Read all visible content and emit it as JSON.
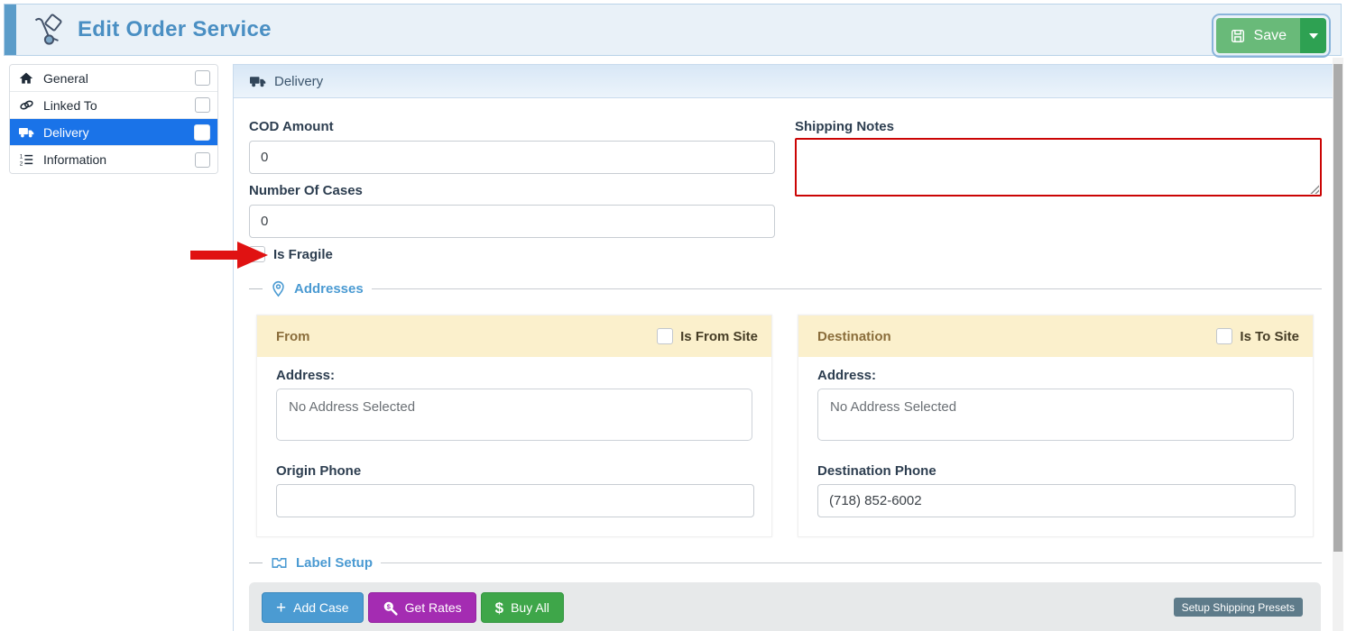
{
  "header": {
    "title": "Edit Order Service",
    "save": {
      "label": "Save"
    }
  },
  "sidebar": {
    "items": [
      {
        "label": "General",
        "icon": "home-icon",
        "active": false
      },
      {
        "label": "Linked To",
        "icon": "link-icon",
        "active": false
      },
      {
        "label": "Delivery",
        "icon": "truck-icon",
        "active": true
      },
      {
        "label": "Information",
        "icon": "ordered-list-icon",
        "active": false
      }
    ]
  },
  "panel": {
    "title": "Delivery"
  },
  "form": {
    "cod_amount": {
      "label": "COD Amount",
      "value": "0"
    },
    "number_of_cases": {
      "label": "Number Of Cases",
      "value": "0"
    },
    "is_fragile": {
      "label": "Is Fragile",
      "checked": false
    },
    "shipping_notes": {
      "label": "Shipping Notes",
      "value": ""
    }
  },
  "addresses": {
    "section_title": "Addresses",
    "from": {
      "title": "From",
      "site_label": "Is From Site",
      "site_checked": false,
      "address_label": "Address:",
      "address_value": "No Address Selected",
      "phone_label": "Origin Phone",
      "phone_value": ""
    },
    "destination": {
      "title": "Destination",
      "site_label": "Is To Site",
      "site_checked": false,
      "address_label": "Address:",
      "address_value": "No Address Selected",
      "phone_label": "Destination Phone",
      "phone_value": "(718) 852-6002"
    }
  },
  "label_setup": {
    "section_title": "Label Setup",
    "add_case": "Add Case",
    "get_rates": "Get Rates",
    "buy_all": "Buy All",
    "setup_presets": "Setup Shipping Presets",
    "glyphs": {
      "plus": "+",
      "dollar": "$"
    }
  },
  "colors": {
    "active_blue": "#1a73e8",
    "section_blue": "#4a9ad2",
    "highlight_red": "#cb0404",
    "arrow_red": "#e01212",
    "save_green": "#69ba79",
    "save_caret_green": "#2ea152",
    "from_header_bg": "#fbf0cc"
  }
}
